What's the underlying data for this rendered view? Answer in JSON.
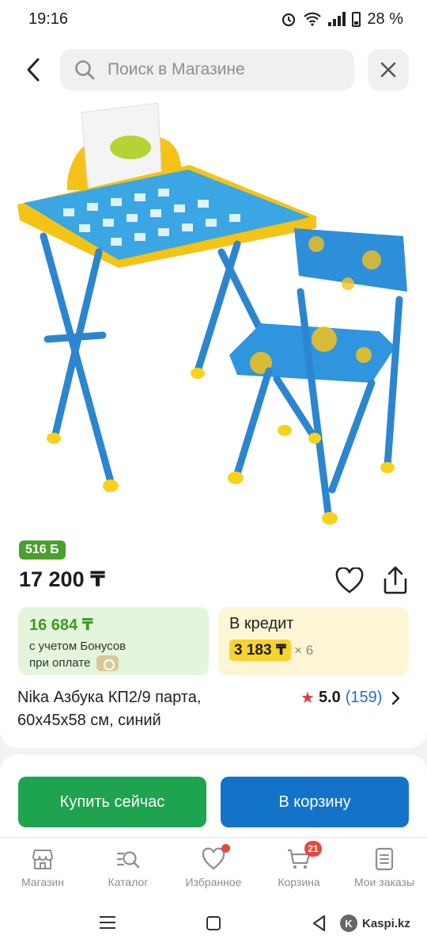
{
  "status_bar": {
    "time": "19:16",
    "battery": "28 %"
  },
  "header": {
    "search_placeholder": "Поиск в Магазине"
  },
  "product": {
    "bonus_tag": "516 Б",
    "price": "17 200 ₸",
    "bonus_price": "16 684 ₸",
    "bonus_note_line1": "с учетом Бонусов",
    "bonus_note_line2": "при оплате",
    "credit_title": "В кредит",
    "credit_payment": "3 183 ₸",
    "credit_months": "× 6",
    "title": "Nika Азбука КП2/9 парта, 60х45х58 см, синий",
    "rating": "5.0",
    "reviews": "(159)"
  },
  "actions": {
    "buy_now": "Купить сейчас",
    "add_to_cart": "В корзину"
  },
  "tabs": [
    {
      "label": "Магазин",
      "icon": "shop-icon"
    },
    {
      "label": "Каталог",
      "icon": "catalog-icon"
    },
    {
      "label": "Избранное",
      "icon": "heart-icon"
    },
    {
      "label": "Корзина",
      "icon": "cart-icon",
      "badge": "21"
    },
    {
      "label": "Мои заказы",
      "icon": "orders-icon"
    }
  ],
  "system_nav": {
    "brand": "Kaspi.kz"
  },
  "colors": {
    "green": "#1ea34f",
    "blue": "#1273c9",
    "bonus_green": "#4aa02c",
    "credit_yellow": "#f8d22f",
    "badge_red": "#e8483c"
  }
}
